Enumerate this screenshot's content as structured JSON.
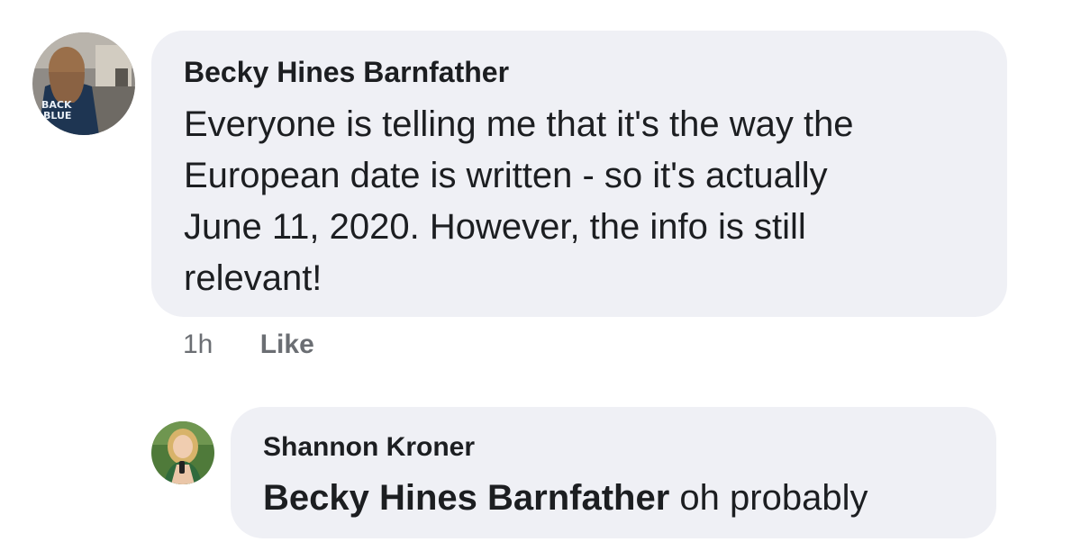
{
  "comments": [
    {
      "author": "Becky Hines Barnfather",
      "avatar_icon": "profile-photo-back-the-blue",
      "avatar_lettering": [
        "BACK",
        "BLUE"
      ],
      "text_lines": [
        "Everyone is telling me that it's the way the",
        "European date is written - so it's actually",
        "June 11, 2020. However, the info is still",
        "relevant!"
      ],
      "timestamp": "1h",
      "like_label": "Like"
    }
  ],
  "replies": [
    {
      "author": "Shannon Kroner",
      "avatar_icon": "profile-photo-woman-green",
      "mention": "Becky Hines Barnfather",
      "text": "oh probably"
    }
  ],
  "colors": {
    "bubble": "#eff0f5",
    "meta_text": "#6b6e73",
    "text": "#1c1e21"
  }
}
